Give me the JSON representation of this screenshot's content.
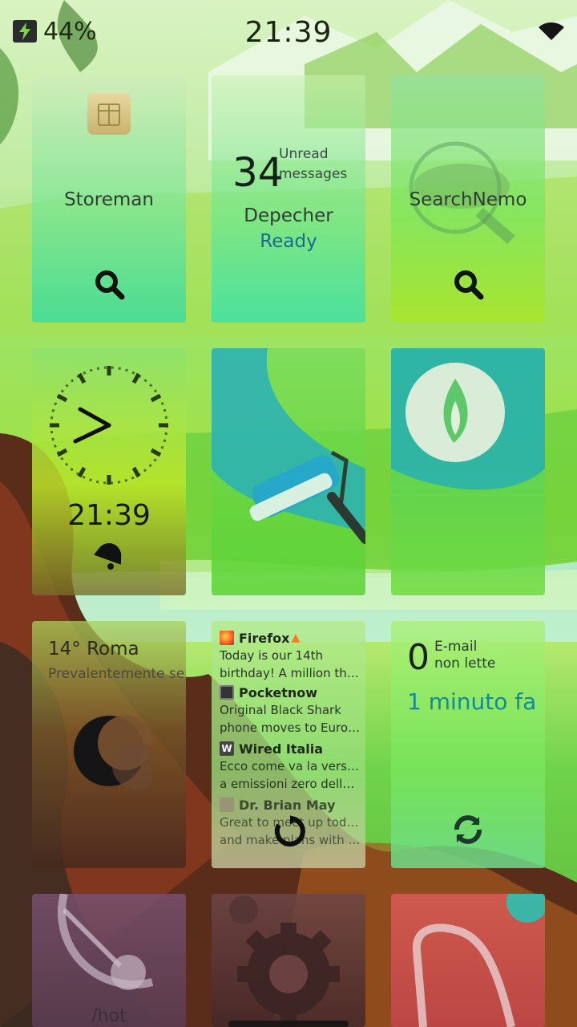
{
  "status_bar": {
    "battery": "44%",
    "time": "21:39"
  },
  "tiles": {
    "storeman": {
      "label": "Storeman"
    },
    "depecher": {
      "count": "34",
      "unread_line1": "Unread",
      "unread_line2": "messages",
      "name": "Depecher",
      "status": "Ready"
    },
    "searchnemo": {
      "label": "SearchNemo"
    },
    "clock": {
      "time": "21:39"
    },
    "weather": {
      "city": "14° Roma",
      "description": "Prevalentemente sereno"
    },
    "feeds": [
      {
        "source": "Firefox",
        "icon": "firefox-icon",
        "line1": "Today is our 14th",
        "line2": "birthday! A million than…"
      },
      {
        "source": "Pocketnow",
        "icon": "pocketnow-icon",
        "line1": "Original Black Shark",
        "line2": "phone moves to Europ…"
      },
      {
        "source": "Wired Italia",
        "icon": "wired-icon",
        "line1": "Ecco come va la versione",
        "line2": "a emissioni zero dell…"
      },
      {
        "source": "Dr. Brian May",
        "icon": "avatar-icon",
        "line1": "Great to meet up today",
        "line2": "and make plans with th…"
      }
    ],
    "mail": {
      "count": "0",
      "label_line1": "E-mail",
      "label_line2": "non lette",
      "updated": "1 minuto fa"
    },
    "hot": {
      "label": "/hot"
    }
  },
  "colors": {
    "accent_blue": "#1a6a8a",
    "mail_teal": "#138a9a"
  }
}
